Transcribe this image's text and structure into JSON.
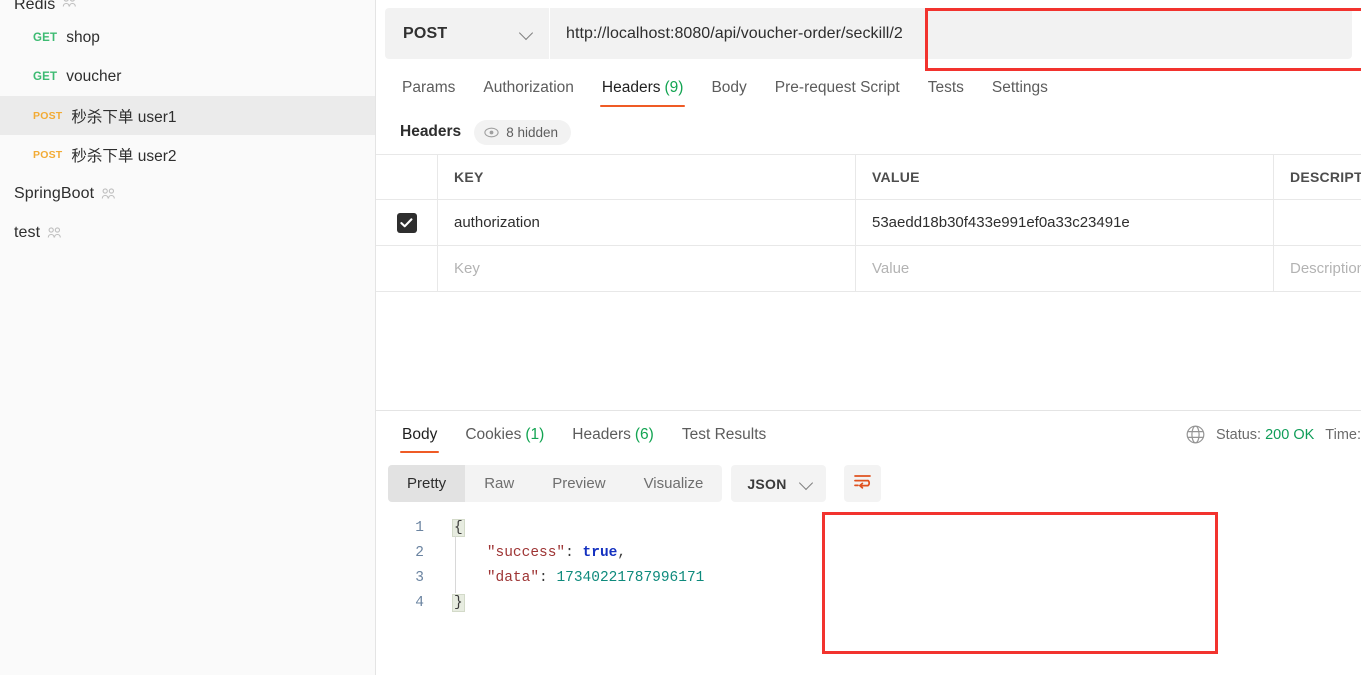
{
  "sidebar": {
    "collections": [
      {
        "name": "Redis",
        "icon": "people-icon"
      },
      {
        "name": "SpringBoot",
        "icon": "people-icon"
      },
      {
        "name": "test",
        "icon": "people-icon"
      }
    ],
    "requests": [
      {
        "method": "GET",
        "name": "shop",
        "active": false
      },
      {
        "method": "GET",
        "name": "voucher",
        "active": false
      },
      {
        "method": "POST",
        "name": "秒杀下单 user1",
        "active": true
      },
      {
        "method": "POST",
        "name": "秒杀下单 user2",
        "active": false
      }
    ]
  },
  "request": {
    "method": "POST",
    "url": "http://localhost:8080/api/voucher-order/seckill/2",
    "tabs": [
      {
        "label": "Params",
        "count": "",
        "active": false
      },
      {
        "label": "Authorization",
        "count": "",
        "active": false
      },
      {
        "label": "Headers",
        "count": "(9)",
        "active": true
      },
      {
        "label": "Body",
        "count": "",
        "active": false
      },
      {
        "label": "Pre-request Script",
        "count": "",
        "active": false
      },
      {
        "label": "Tests",
        "count": "",
        "active": false
      },
      {
        "label": "Settings",
        "count": "",
        "active": false
      }
    ],
    "headers_section": {
      "label": "Headers",
      "hidden_badge": "8 hidden",
      "columns": [
        "KEY",
        "VALUE",
        "DESCRIPTION"
      ],
      "rows": [
        {
          "checked": true,
          "key": "authorization",
          "value": "53aedd18b30f433e991ef0a33c23491e",
          "description": ""
        }
      ],
      "placeholder_row": {
        "key": "Key",
        "value": "Value",
        "description": "Description"
      }
    }
  },
  "response": {
    "tabs": [
      {
        "label": "Body",
        "count": "",
        "active": true
      },
      {
        "label": "Cookies",
        "count": "(1)",
        "active": false
      },
      {
        "label": "Headers",
        "count": "(6)",
        "active": false
      },
      {
        "label": "Test Results",
        "count": "",
        "active": false
      }
    ],
    "status_label": "Status:",
    "status_value": "200 OK",
    "time_label": "Time:",
    "view_modes": [
      {
        "label": "Pretty",
        "active": true
      },
      {
        "label": "Raw",
        "active": false
      },
      {
        "label": "Preview",
        "active": false
      },
      {
        "label": "Visualize",
        "active": false
      }
    ],
    "format": "JSON",
    "body_lines": [
      "1",
      "2",
      "3",
      "4"
    ],
    "body": {
      "open_brace": "{",
      "line2_key": "\"success\"",
      "line2_colon": ": ",
      "line2_value": "true",
      "line2_comma": ",",
      "line3_key": "\"data\"",
      "line3_colon": ": ",
      "line3_value": "17340221787996171",
      "close_brace": "}"
    }
  },
  "colors": {
    "accent_orange": "#ef5b25",
    "get_green": "#3dbb72",
    "post_amber": "#f2ab35",
    "status_green": "#0f9d58",
    "annotation_red": "#f2332e"
  }
}
